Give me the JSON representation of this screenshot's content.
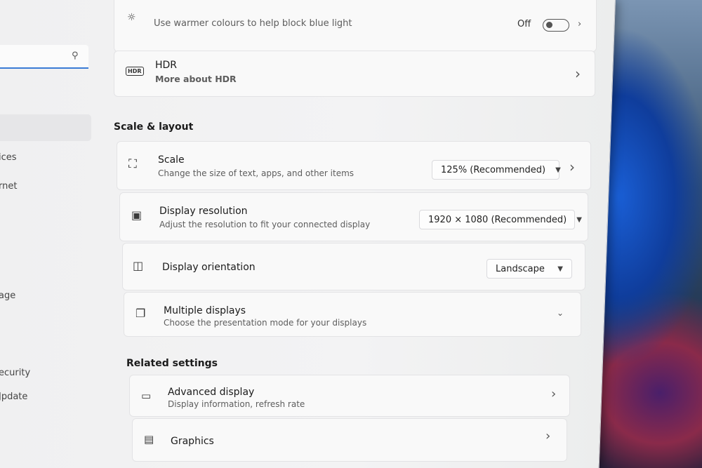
{
  "nav": {
    "items": [
      "ices",
      "rnet",
      "age",
      "ecurity",
      "Jpdate"
    ]
  },
  "night_light": {
    "subtitle": "Use warmer colours to help block blue light",
    "state": "Off"
  },
  "hdr": {
    "title": "HDR",
    "link": "More about HDR",
    "icon": "hdr-icon"
  },
  "scale_layout": {
    "heading": "Scale & layout",
    "scale": {
      "title": "Scale",
      "subtitle": "Change the size of text, apps, and other items",
      "value": "125% (Recommended)"
    },
    "resolution": {
      "title": "Display resolution",
      "subtitle": "Adjust the resolution to fit your connected display",
      "value": "1920 × 1080 (Recommended)"
    },
    "orientation": {
      "title": "Display orientation",
      "value": "Landscape"
    },
    "multiple": {
      "title": "Multiple displays",
      "subtitle": "Choose the presentation mode for your displays"
    }
  },
  "related": {
    "heading": "Related settings",
    "advanced": {
      "title": "Advanced display",
      "subtitle": "Display information, refresh rate"
    },
    "graphics": {
      "title": "Graphics"
    }
  },
  "colors": {
    "accent": "#1f5fbf",
    "search_underline": "#3a7bd5"
  }
}
